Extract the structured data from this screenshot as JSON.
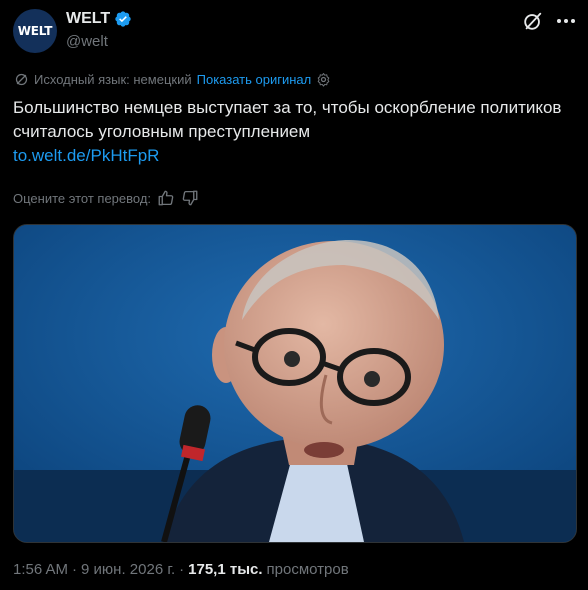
{
  "account": {
    "avatar_text": "WELT",
    "name": "WELT",
    "handle": "@welt",
    "verified": true,
    "avatar_bg": "#13305a"
  },
  "icons": {
    "verified": "verified-badge-icon",
    "grok": "grok-icon",
    "more": "more-icon",
    "translate": "translate-icon",
    "settings": "gear-icon",
    "thumbs_up": "thumbs-up-icon",
    "thumbs_down": "thumbs-down-icon"
  },
  "translation": {
    "source_label": "Исходный язык: немецкий",
    "show_original": "Показать оригинал"
  },
  "tweet": {
    "text": "Большинство немцев выступает за то, чтобы оскорбление политиков считалось уголовным преступлением",
    "link": "to.welt.de/PkHtFpR"
  },
  "rating": {
    "label": "Оцените этот перевод:"
  },
  "meta": {
    "time": "1:56 AM",
    "date": "9 июн. 2026 г.",
    "views_count": "175,1 тыс.",
    "views_label": "просмотров"
  },
  "colors": {
    "background": "#000000",
    "text": "#e7e9ea",
    "muted": "#71767b",
    "link": "#1d9bf0",
    "photo_bg": "#0d4f8f"
  }
}
